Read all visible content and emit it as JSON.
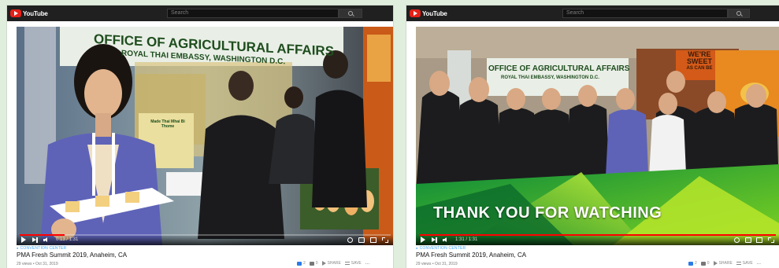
{
  "app": {
    "name": "YouTube"
  },
  "left": {
    "search_placeholder": "Search",
    "video": {
      "banner_line1": "OFFICE OF AGRICULTURAL AFFAIRS",
      "banner_line2": "ROYAL THAI EMBASSY, WASHINGTON D.C.",
      "sign_line1": "Made Thai Mhai Bi Thome",
      "time": "0:13 / 1:31",
      "progress": 0.12
    },
    "tag": "CONVENTION CENTER",
    "title": "PMA Fresh Summit 2019, Anaheim, CA",
    "meta": "29 views • Oct 31, 2019",
    "likes": "2",
    "dislikes": "0",
    "share_label": "SHARE",
    "save_label": "SAVE",
    "more_label": "..."
  },
  "right": {
    "search_placeholder": "Search",
    "video": {
      "banner_line1": "OFFICE OF AGRICULTURAL AFFAIRS",
      "banner_line2": "ROYAL THAI EMBASSY, WASHINGTON D.C.",
      "sweet_line1": "WE'RE",
      "sweet_line2": "SWEET",
      "sweet_line3": "AS CAN BE",
      "overlay_text": "THANK YOU FOR WATCHING",
      "time": "1:31 / 1:31",
      "progress": 1.0
    },
    "tag": "CONVENTION CENTER",
    "title": "PMA Fresh Summit 2019, Anaheim, CA",
    "meta": "29 views • Oct 31, 2019",
    "likes": "2",
    "dislikes": "0",
    "share_label": "SHARE",
    "save_label": "SAVE",
    "more_label": "..."
  },
  "colors": {
    "accent": "#ff0000",
    "brand": "#e62117",
    "background": "#dfeedd"
  }
}
